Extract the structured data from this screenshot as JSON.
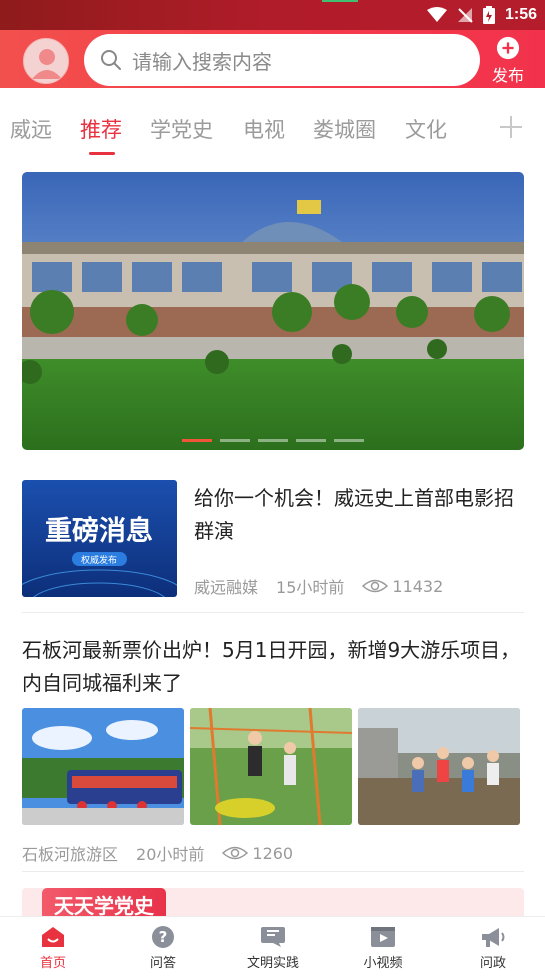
{
  "status_bar": {
    "time": "1:56"
  },
  "header": {
    "search_placeholder": "请输入搜索内容",
    "publish_label": "发布"
  },
  "tabs": [
    {
      "label": "威远"
    },
    {
      "label": "推荐",
      "active": true
    },
    {
      "label": "学党史"
    },
    {
      "label": "电视"
    },
    {
      "label": "娄城圈"
    },
    {
      "label": "文化"
    }
  ],
  "banner": {
    "slides": 5,
    "active_slide": 1
  },
  "article1": {
    "title": "给你一个机会！威远史上首部电影招群演",
    "thumb_text": "重磅消息",
    "thumb_subtext": "权威发布",
    "source": "威远融媒",
    "time": "15小时前",
    "views": "11432"
  },
  "article2": {
    "title": "石板河最新票价出炉！5月1日开园，新增9大游乐项目，内自同城福利来了",
    "source": "石板河旅游区",
    "time": "20小时前",
    "views": "1260"
  },
  "promo": {
    "tag": "天天学党史"
  },
  "bottom_nav": [
    {
      "label": "首页",
      "icon": "home-icon",
      "active": true
    },
    {
      "label": "问答",
      "icon": "question-icon"
    },
    {
      "label": "文明实践",
      "icon": "flag-icon"
    },
    {
      "label": "小视频",
      "icon": "video-icon"
    },
    {
      "label": "问政",
      "icon": "megaphone-icon"
    }
  ],
  "colors": {
    "accent": "#e8323f",
    "header": "#f53d4b",
    "status_bar": "#b11c2a"
  }
}
